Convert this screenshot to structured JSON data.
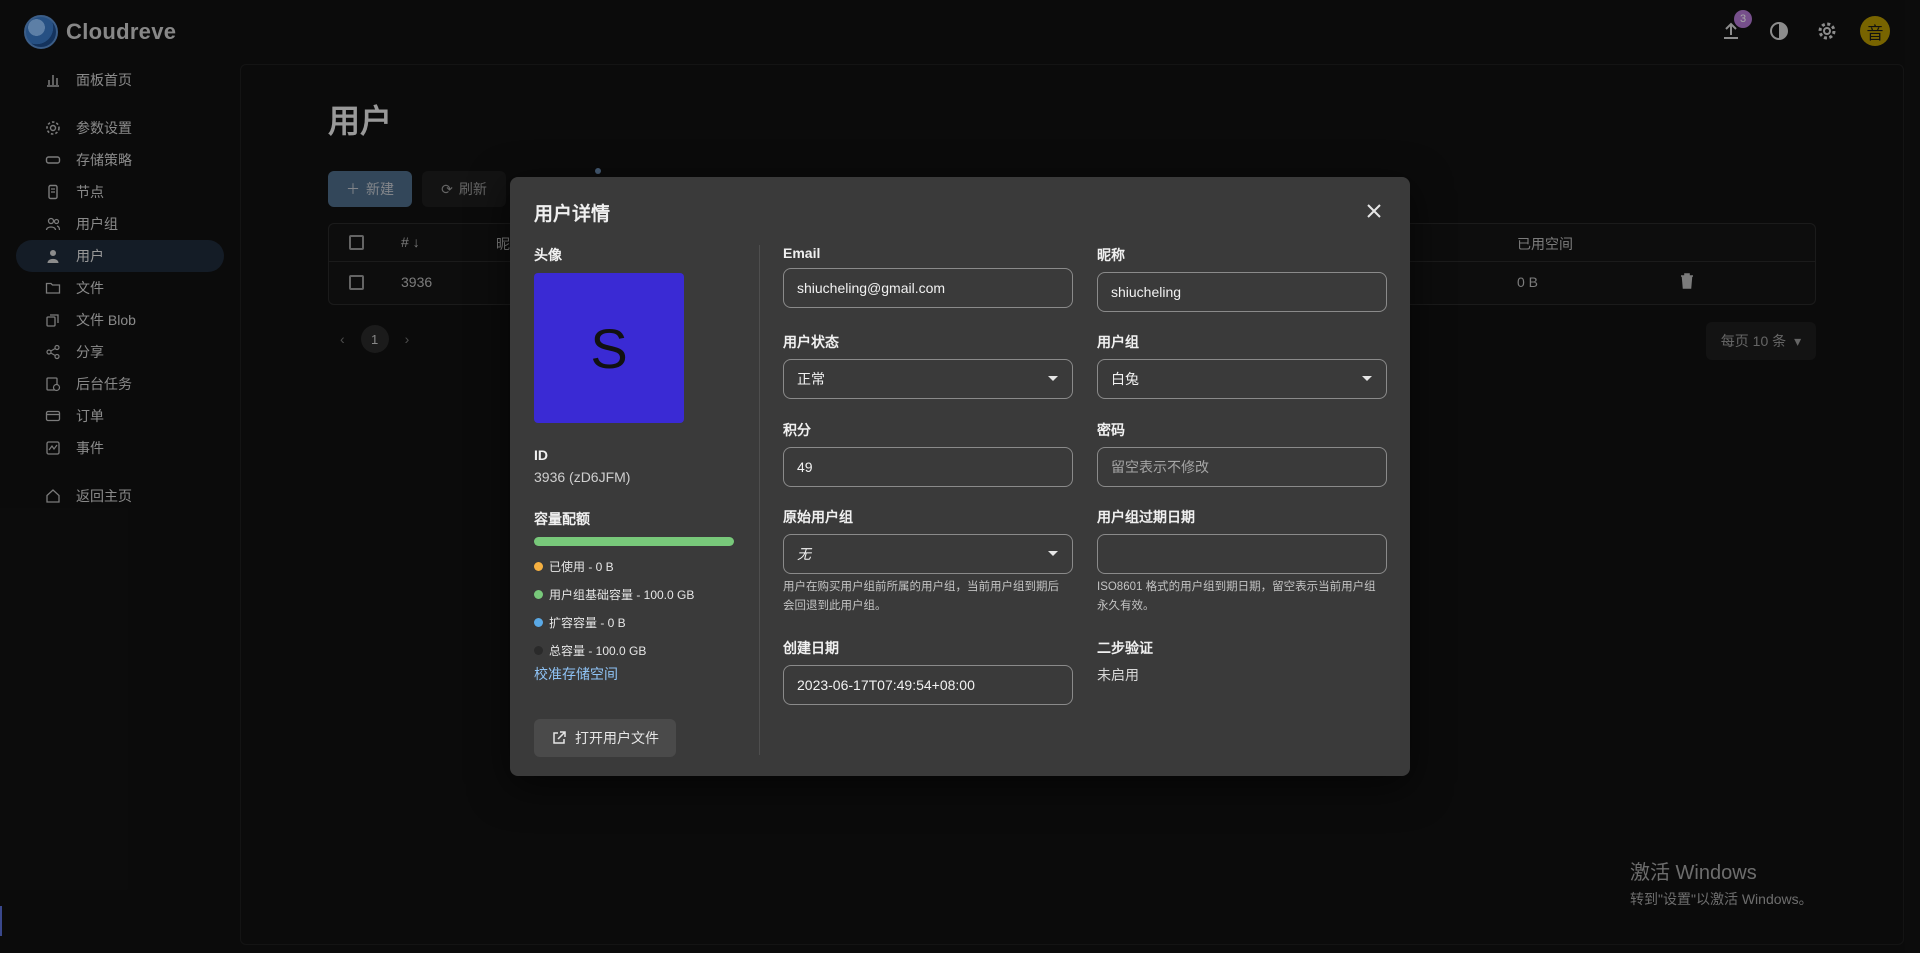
{
  "app": {
    "name": "Cloudreve",
    "upload_badge": "3",
    "avatar_char": "音"
  },
  "sidebar": {
    "items": [
      {
        "label": "面板首页",
        "icon": "bar-chart-icon"
      },
      {
        "label": "参数设置",
        "icon": "gear-icon"
      },
      {
        "label": "存储策略",
        "icon": "storage-icon"
      },
      {
        "label": "节点",
        "icon": "server-icon"
      },
      {
        "label": "用户组",
        "icon": "users-icon"
      },
      {
        "label": "用户",
        "icon": "user-icon"
      },
      {
        "label": "文件",
        "icon": "folder-icon"
      },
      {
        "label": "文件 Blob",
        "icon": "blob-icon"
      },
      {
        "label": "分享",
        "icon": "share-icon"
      },
      {
        "label": "后台任务",
        "icon": "task-icon"
      },
      {
        "label": "订单",
        "icon": "card-icon"
      },
      {
        "label": "事件",
        "icon": "event-icon"
      },
      {
        "label": "返回主页",
        "icon": "home-icon"
      }
    ]
  },
  "page": {
    "title": "用户",
    "new_label": "新建",
    "refresh_label": "刷新",
    "table": {
      "headers": {
        "id": "#",
        "nick": "昵",
        "used": "已用空间"
      },
      "row": {
        "id": "3936",
        "used": "0 B"
      }
    },
    "pager": {
      "current": "1",
      "per_page": "每页 10 条"
    }
  },
  "dialog": {
    "title": "用户详情",
    "avatar_label": "头像",
    "avatar_letter": "S",
    "avatar_color": "#3a2ad4",
    "id_label": "ID",
    "id_value": "3936 (zD6JFM)",
    "quota_label": "容量配额",
    "quota_used_fraction": 0,
    "legend": [
      {
        "text": "已使用 - 0 B",
        "color": "#f5b041"
      },
      {
        "text": "用户组基础容量 - 100.0 GB",
        "color": "#78c87a"
      },
      {
        "text": "扩容容量 - 0 B",
        "color": "#5aa9e6"
      },
      {
        "text": "总容量 - 100.0 GB",
        "color": "#2a2a2a"
      }
    ],
    "calibrate_link": "校准存储空间",
    "open_files_label": "打开用户文件",
    "fields": {
      "email": {
        "label": "Email",
        "value": "shiucheling@gmail.com"
      },
      "nick": {
        "label": "昵称",
        "value": "shiucheling"
      },
      "status": {
        "label": "用户状态",
        "value": "正常"
      },
      "group": {
        "label": "用户组",
        "value": "白兔"
      },
      "credit": {
        "label": "积分",
        "value": "49"
      },
      "password": {
        "label": "密码",
        "placeholder": "留空表示不修改"
      },
      "orig_group": {
        "label": "原始用户组",
        "value": "无",
        "helper": "用户在购买用户组前所属的用户组，当前用户组到期后会回退到此用户组。"
      },
      "group_expire": {
        "label": "用户组过期日期",
        "value": "",
        "helper": "ISO8601 格式的用户组到期日期，留空表示当前用户组永久有效。"
      },
      "created": {
        "label": "创建日期",
        "value": "2023-06-17T07:49:54+08:00"
      },
      "twofa": {
        "label": "二步验证",
        "value": "未启用"
      }
    }
  },
  "watermark": {
    "line1": "激活 Windows",
    "line2": "转到\"设置\"以激活 Windows。"
  }
}
